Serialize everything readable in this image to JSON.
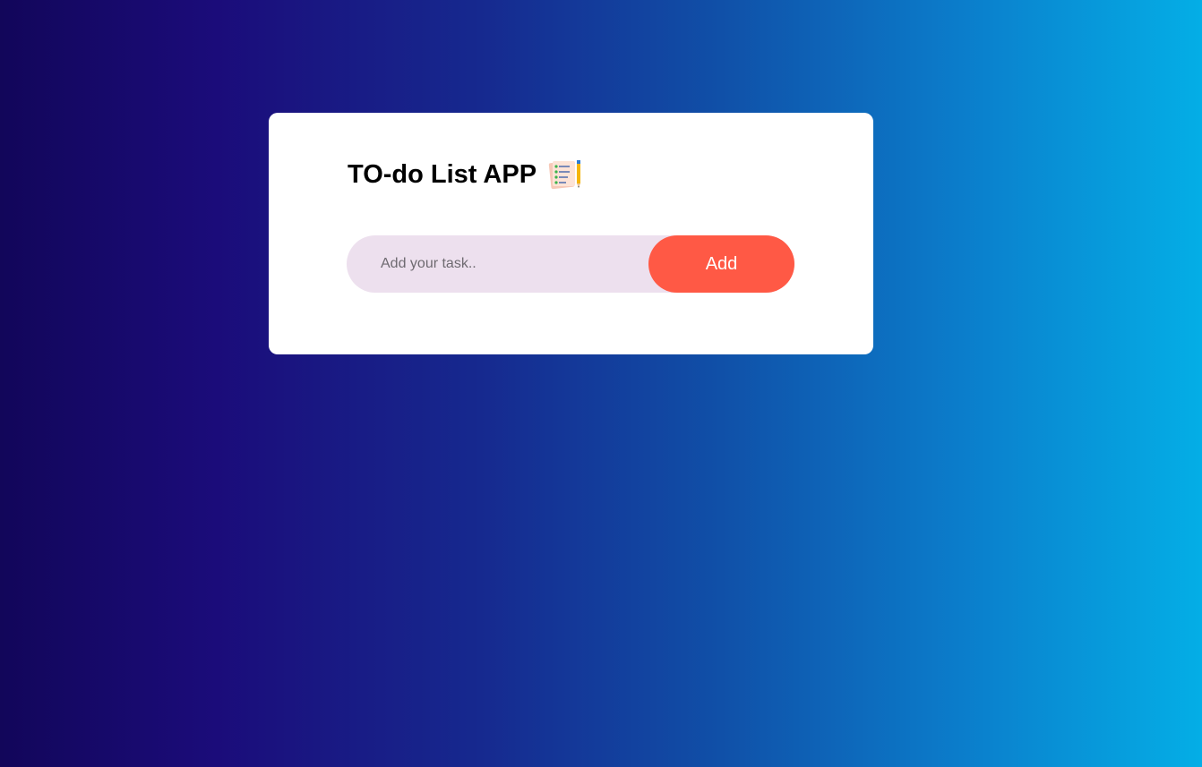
{
  "app": {
    "title": "TO-do List APP",
    "title_icon": "checklist-with-pencil-icon"
  },
  "task_form": {
    "input_placeholder": "Add your task..",
    "input_value": "",
    "add_label": "Add"
  },
  "colors": {
    "background_gradient_start": "#12065a",
    "background_gradient_end": "#04aee6",
    "card": "#ffffff",
    "input_background": "#ede0ee",
    "add_button": "#ff5945"
  }
}
